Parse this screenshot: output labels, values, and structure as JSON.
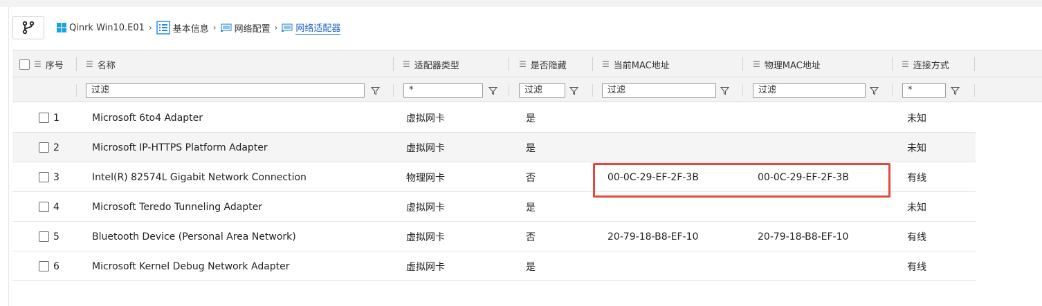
{
  "breadcrumb": {
    "items": [
      {
        "label": "Qinrk Win10.E01",
        "icon": "windows-icon"
      },
      {
        "label": "基本信息",
        "icon": "list-icon"
      },
      {
        "label": "网络配置",
        "icon": "network-icon"
      },
      {
        "label": "网络适配器",
        "icon": "network-icon"
      }
    ]
  },
  "table": {
    "headers": {
      "index": "序号",
      "name": "名称",
      "type": "适配器类型",
      "hidden": "是否隐藏",
      "cur_mac": "当前MAC地址",
      "phy_mac": "物理MAC地址",
      "conn": "连接方式"
    },
    "filters": {
      "name": "过滤",
      "type": "*",
      "hidden": "过滤",
      "cur_mac": "过滤",
      "phy_mac": "过滤",
      "conn": "*"
    },
    "rows": [
      {
        "index": "1",
        "name": "Microsoft 6to4 Adapter",
        "type": "虚拟网卡",
        "hidden": "是",
        "cur_mac": "",
        "phy_mac": "",
        "conn": "未知"
      },
      {
        "index": "2",
        "name": "Microsoft IP-HTTPS Platform Adapter",
        "type": "虚拟网卡",
        "hidden": "是",
        "cur_mac": "",
        "phy_mac": "",
        "conn": "未知"
      },
      {
        "index": "3",
        "name": "Intel(R) 82574L Gigabit Network Connection",
        "type": "物理网卡",
        "hidden": "否",
        "cur_mac": "00-0C-29-EF-2F-3B",
        "phy_mac": "00-0C-29-EF-2F-3B",
        "conn": "有线"
      },
      {
        "index": "4",
        "name": "Microsoft Teredo Tunneling Adapter",
        "type": "虚拟网卡",
        "hidden": "是",
        "cur_mac": "",
        "phy_mac": "",
        "conn": "未知"
      },
      {
        "index": "5",
        "name": "Bluetooth Device (Personal Area Network)",
        "type": "虚拟网卡",
        "hidden": "否",
        "cur_mac": "20-79-18-B8-EF-10",
        "phy_mac": "20-79-18-B8-EF-10",
        "conn": "有线"
      },
      {
        "index": "6",
        "name": "Microsoft Kernel Debug Network Adapter",
        "type": "虚拟网卡",
        "hidden": "是",
        "cur_mac": "",
        "phy_mac": "",
        "conn": "有线"
      }
    ]
  },
  "colors": {
    "accent": "#1e63c7",
    "highlight": "#e8453c",
    "header_bg": "#f3f3f3"
  }
}
